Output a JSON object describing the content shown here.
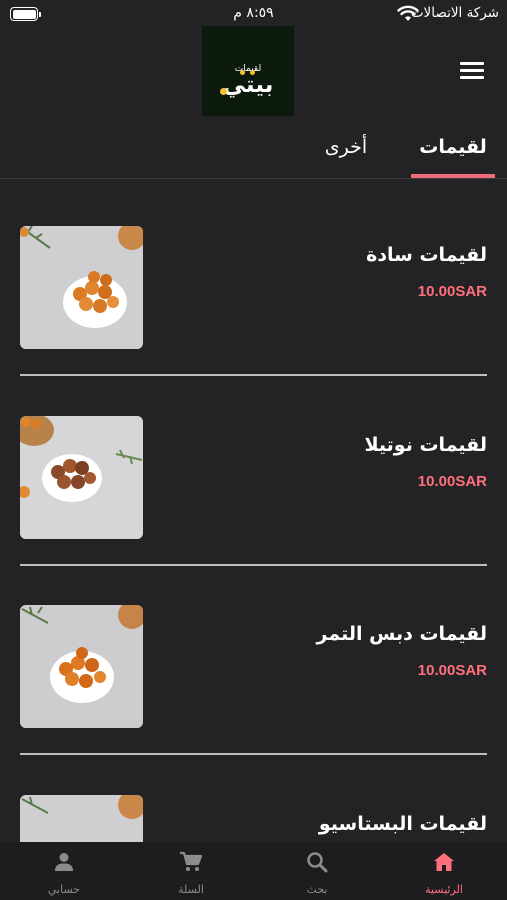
{
  "status_bar": {
    "carrier": "شركة الاتصالات",
    "time": "٨:٥٩ م"
  },
  "header": {
    "logo_top_text": "لقيمات",
    "logo_main_text": "بيتي",
    "menu_icon": "hamburger-menu-icon"
  },
  "tabs": [
    {
      "label": "لقيمات",
      "active": true
    },
    {
      "label": "أخرى",
      "active": false
    }
  ],
  "colors": {
    "accent": "#ee6b7a",
    "price": "#ff707d",
    "background": "#232325"
  },
  "products": [
    {
      "name": "لقيمات سادة",
      "price": "10.00SAR"
    },
    {
      "name": "لقيمات نوتيلا",
      "price": "10.00SAR"
    },
    {
      "name": "لقيمات دبس التمر",
      "price": "10.00SAR"
    },
    {
      "name": "لقيمات البستاسيو",
      "price": ""
    }
  ],
  "bottom_nav": [
    {
      "label": "الرئيسية",
      "icon": "home-icon",
      "active": true
    },
    {
      "label": "بحث",
      "icon": "search-icon",
      "active": false
    },
    {
      "label": "السلة",
      "icon": "cart-icon",
      "active": false
    },
    {
      "label": "حسابي",
      "icon": "person-icon",
      "active": false
    }
  ]
}
